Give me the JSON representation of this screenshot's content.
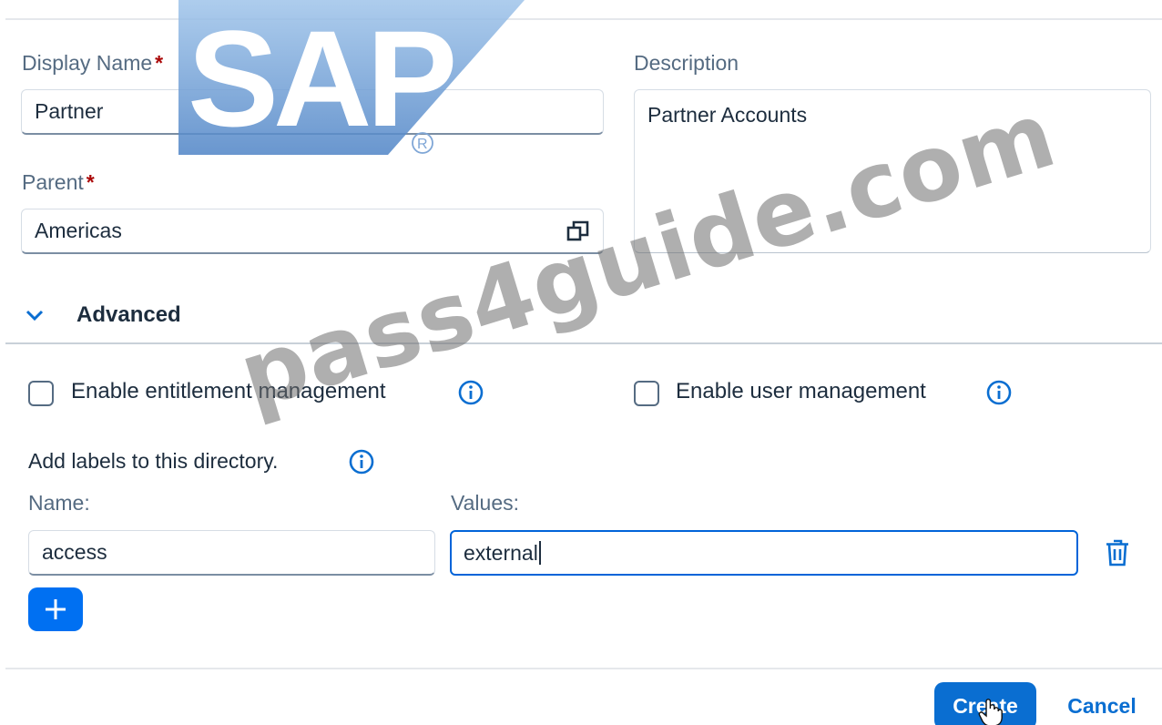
{
  "form": {
    "display_name_label": "Display Name",
    "display_name_value": "Partner",
    "description_label": "Description",
    "description_value": "Partner Accounts",
    "parent_label": "Parent",
    "parent_value": "Americas",
    "required_marker": "*"
  },
  "advanced": {
    "title": "Advanced",
    "enable_entitlement_label": "Enable entitlement management",
    "enable_entitlement_checked": false,
    "enable_user_mgmt_label": "Enable user management",
    "enable_user_mgmt_checked": false
  },
  "labels_section": {
    "title": "Add labels to this directory.",
    "name_header": "Name:",
    "values_header": "Values:",
    "rows": [
      {
        "name": "access",
        "value": "external"
      }
    ]
  },
  "footer": {
    "create_label": "Create",
    "cancel_label": "Cancel"
  },
  "watermarks": {
    "logo_text": "SAP",
    "site_text": "pass4guide.com"
  },
  "colors": {
    "accent": "#0a6ed1",
    "add_button": "#0070f2",
    "required": "#aa0808",
    "focus_border": "#0064d9"
  },
  "icons": {
    "parent_picker": "value-help-icon",
    "info": "info-icon",
    "delete": "trash-icon",
    "add": "plus-icon",
    "expand": "chevron-down-icon"
  }
}
